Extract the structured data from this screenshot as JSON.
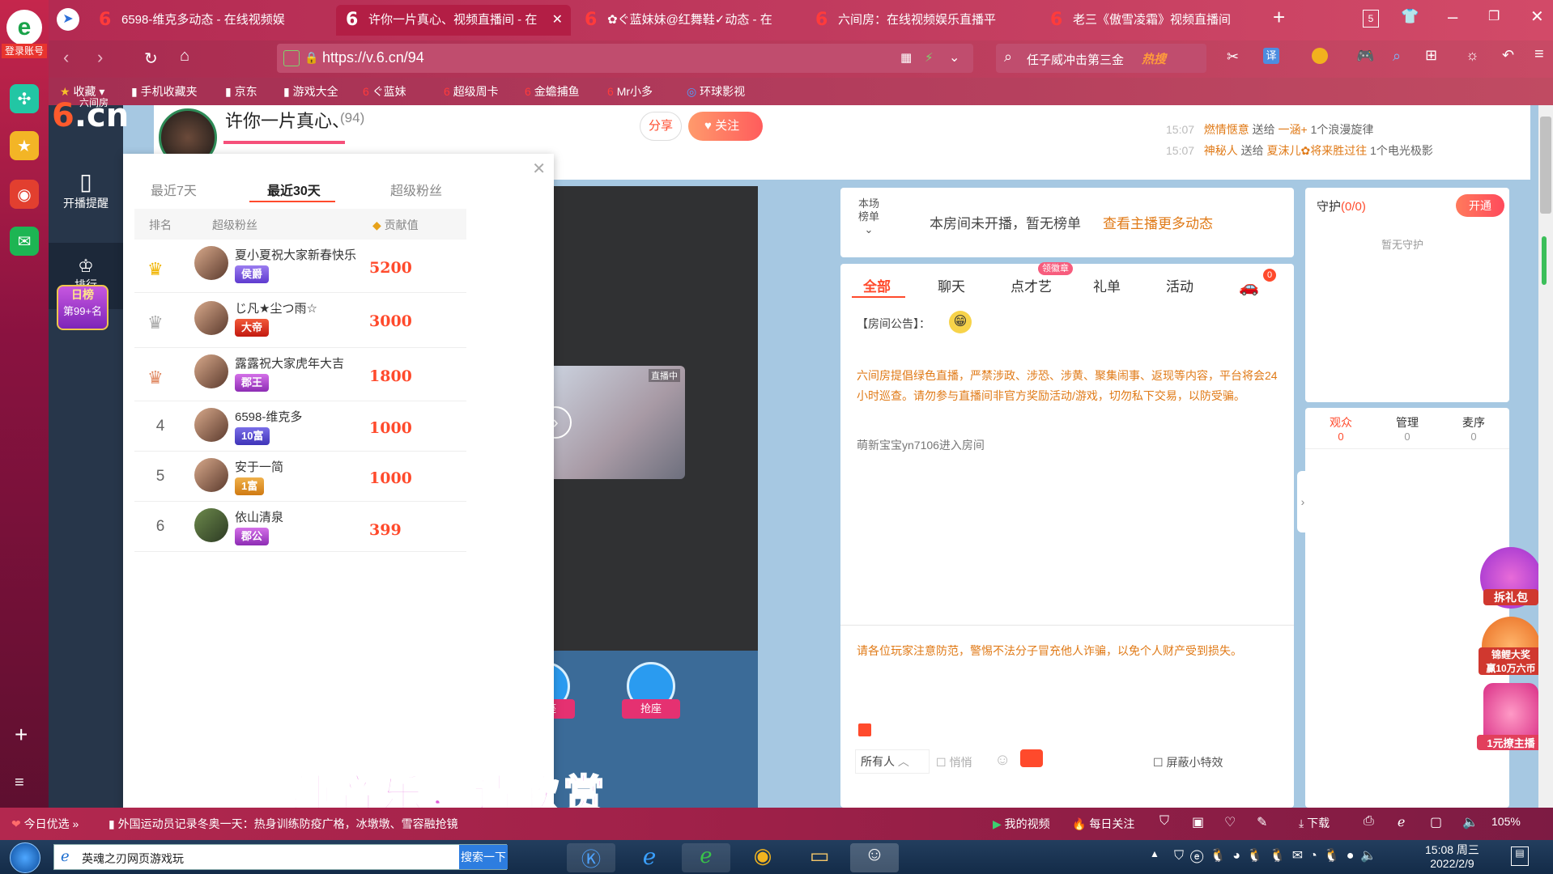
{
  "browser": {
    "login_label": "登录账号",
    "tabs": [
      {
        "label": "6598-维克多动态 - 在线视频娱",
        "active": false
      },
      {
        "label": "许你一片真心、视频直播间 - 在",
        "active": true
      },
      {
        "label": "✿ぐ蓝妹妹@红舞鞋✓动态 - 在",
        "active": false
      },
      {
        "label": "六间房：在线视频娱乐直播平",
        "active": false
      },
      {
        "label": "老三《傲雪凌霜》视频直播间",
        "active": false
      }
    ],
    "tab_count": "5",
    "url": "https://v.6.cn/94",
    "search_placeholder": "任子威冲击第三金",
    "hot_label": "热搜",
    "translate_label": "译",
    "bookmarks": [
      "收藏",
      "手机收藏夹",
      "京东",
      "游戏大全",
      "ぐ蓝妹",
      "超级周卡",
      "金蟾捕鱼",
      "Mr小多",
      "环球影视"
    ]
  },
  "header": {
    "room_title": "许你一片真心、",
    "room_id": "(94)",
    "share": "分享",
    "follow": "关注",
    "gift_feed": [
      {
        "time": "15:07",
        "from": "燃情惬意",
        "verb": "送给",
        "to": "一涵+",
        "item": "1个浪漫旋律"
      },
      {
        "time": "15:07",
        "from": "神秘人",
        "verb": "送给",
        "to": "夏沫儿✿将来胜过往",
        "item": "1个电光极影"
      }
    ]
  },
  "left_nav": {
    "remind": "开播提醒",
    "rank": "排行",
    "daily_title": "日榜",
    "daily_rank": "第99+名",
    "logo_small": "六间房",
    "logo_big": ".cn"
  },
  "rank_panel": {
    "tabs": [
      "最近7天",
      "最近30天",
      "超级粉丝"
    ],
    "active_tab": 1,
    "columns": [
      "排名",
      "超级粉丝",
      "贡献值"
    ],
    "rows": [
      {
        "rank": "1",
        "name": "夏小夏祝大家新春快乐",
        "badge": "侯爵",
        "value": "5200"
      },
      {
        "rank": "2",
        "name": "じ凡★尘つ雨☆",
        "badge": "大帝",
        "value": "3000"
      },
      {
        "rank": "3",
        "name": "露露祝大家虎年大吉",
        "badge": "郡王",
        "value": "1800"
      },
      {
        "rank": "4",
        "name": "6598-维克多",
        "badge": "10富",
        "value": "1000"
      },
      {
        "rank": "5",
        "name": "安于一简",
        "badge": "1富",
        "value": "1000"
      },
      {
        "rank": "6",
        "name": "依山清泉",
        "badge": "郡公",
        "value": "399"
      }
    ]
  },
  "video": {
    "overlay_char": "点",
    "live_badge": "直播中",
    "seat_label": "抢座",
    "subtitle": "纯音乐，请欣赏"
  },
  "topcard": {
    "label1": "本场",
    "label2": "榜单",
    "text": "本房间未开播，暂无榜单",
    "link": "查看主播更多动态"
  },
  "chat": {
    "tabs": [
      "全部",
      "聊天",
      "点才艺",
      "礼单",
      "活动"
    ],
    "badge": "领徽章",
    "car_count": "0",
    "notice_label": "【房间公告】：",
    "notice": "六间房提倡绿色直播，严禁涉政、涉恐、涉黄、聚集闹事、返现等内容，平台将会24小时巡查。请勿参与直播间非官方奖励活动/游戏，切勿私下交易，以防受骗。",
    "enter_msg": "萌新宝宝yn7106进入房间",
    "warn": "请各位玩家注意防范，警惕不法分子冒充他人诈骗，以免个人财产受到损失。",
    "to_all": "所有人",
    "whisper": "悄悄",
    "hide_fx": "屏蔽小特效"
  },
  "guard": {
    "title": "守护",
    "count": "(0/0)",
    "open": "开通",
    "empty": "暂无守护"
  },
  "audience": {
    "tabs": [
      {
        "label": "观众",
        "count": "0"
      },
      {
        "label": "管理",
        "count": "0"
      },
      {
        "label": "麦序",
        "count": "0"
      }
    ]
  },
  "side_ads": [
    "拆礼包",
    "锦鲤大奖",
    "赢10万六币",
    "1元撩主播"
  ],
  "statusbar": {
    "today": "今日优选",
    "news": "外国运动员记录冬奥一天：热身训练防疫广格，冰墩墩、雪容融抢镜",
    "myvideo": "我的视频",
    "daily": "每日关注",
    "download": "下载",
    "zoom": "105%"
  },
  "taskbar": {
    "ie_title": "英魂之刃网页游戏玩",
    "search_btn": "搜索一下",
    "time": "15:08 周三",
    "date": "2022/2/9"
  },
  "colors": {
    "accent": "#ff4a2c",
    "brand": "#b31e45",
    "orange": "#e07a17"
  }
}
